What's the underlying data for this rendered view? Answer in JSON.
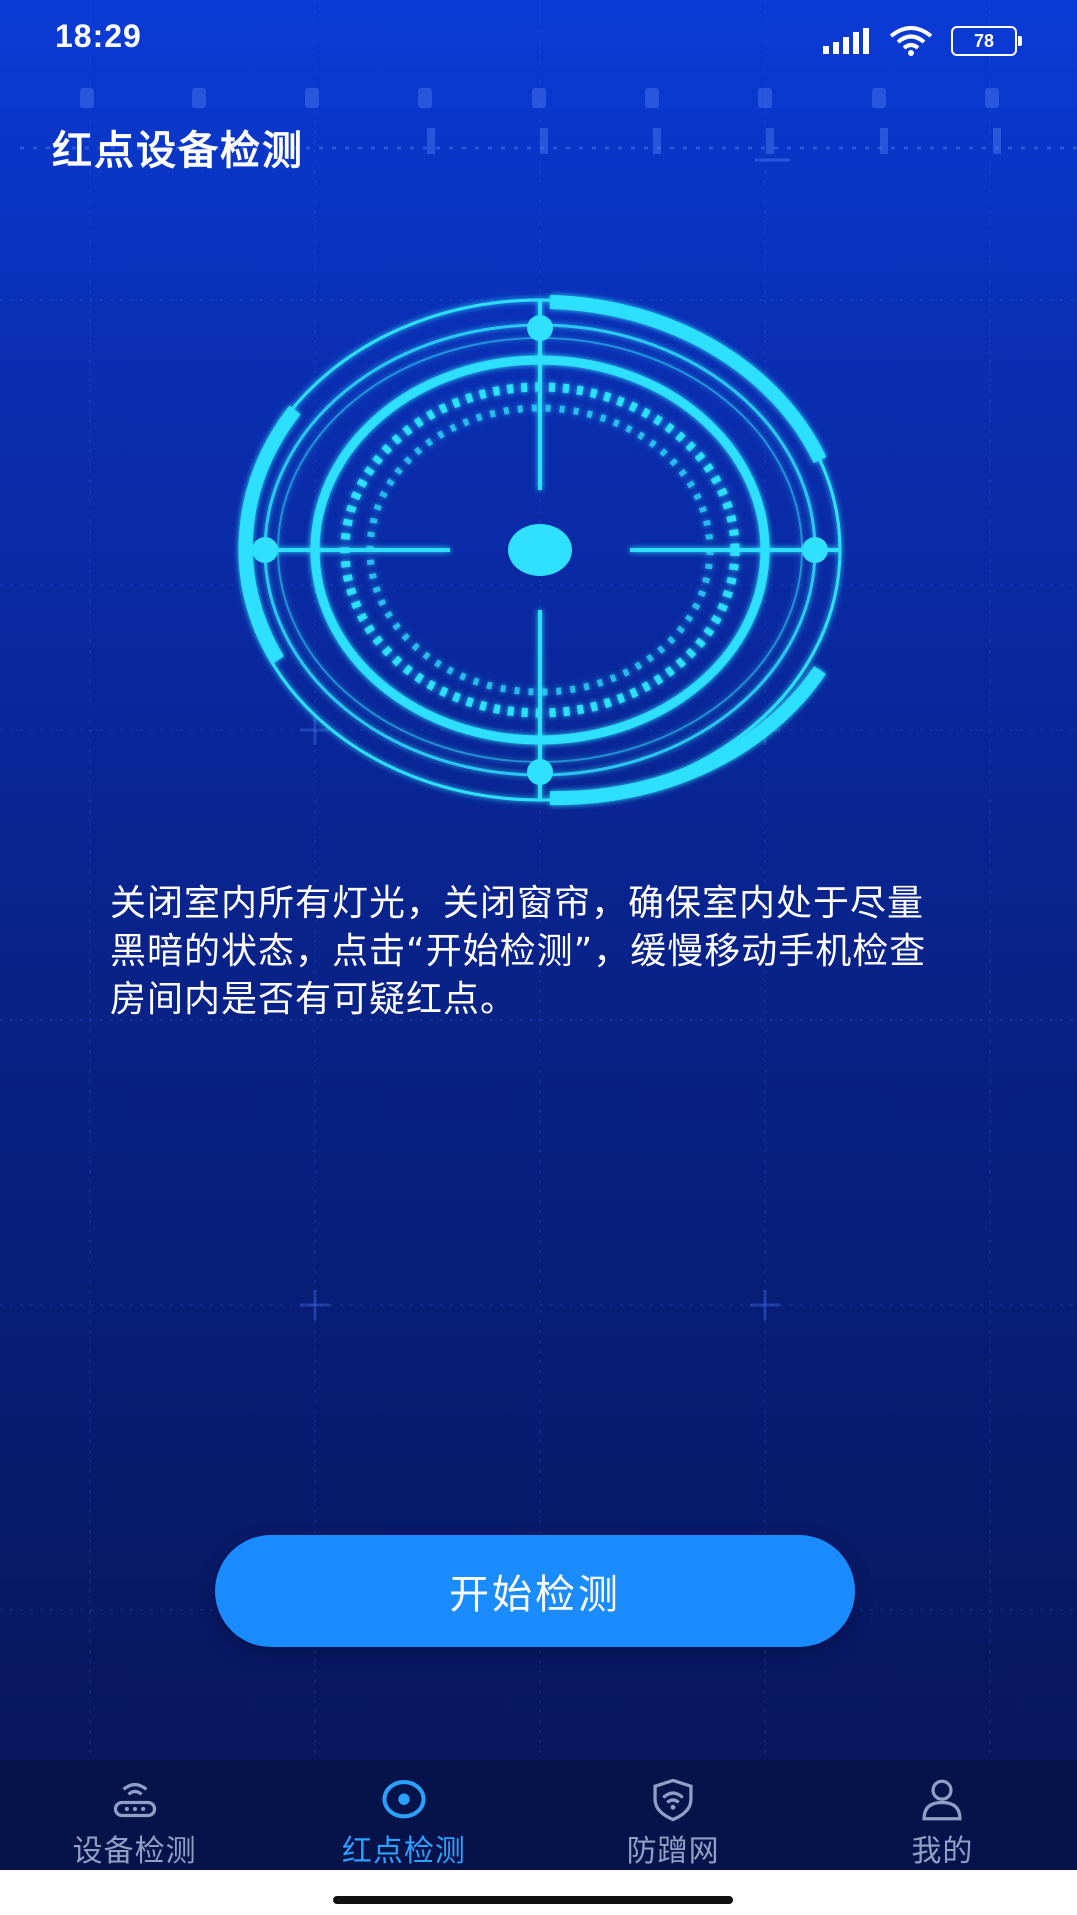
{
  "status_bar": {
    "time": "18:29",
    "battery": "78"
  },
  "page": {
    "title": "红点设备检测"
  },
  "instructions": "关闭室内所有灯光，关闭窗帘，确保室内处于尽量黑暗的状态，点击“开始检测”，缓慢移动手机检查房间内是否有可疑红点。",
  "actions": {
    "start_label": "开始检测"
  },
  "tabs": [
    {
      "label": "设备检测",
      "icon": "router-icon",
      "active": false
    },
    {
      "label": "红点检测",
      "icon": "red-dot-scan-icon",
      "active": true
    },
    {
      "label": "防蹭网",
      "icon": "wifi-shield-icon",
      "active": false
    },
    {
      "label": "我的",
      "icon": "person-icon",
      "active": false
    }
  ],
  "colors": {
    "background_top": "#0a3bd6",
    "background_bottom": "#071658",
    "radar_cyan": "#2fe0ff",
    "button": "#1a8cff",
    "tab_active": "#2aa0ff",
    "tab_inactive": "#8ea0c4"
  }
}
